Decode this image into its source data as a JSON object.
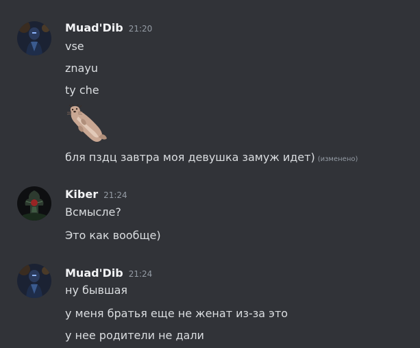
{
  "messages": [
    {
      "username": "Muad'Dib",
      "timestamp": "21:20",
      "lines": [
        "vse",
        "znayu",
        "ty che"
      ],
      "sticker": "otter-sticker",
      "last_line": "бля пздц завтра моя девушка замуж идет)",
      "edited_label": "(изменено)"
    },
    {
      "username": "Kiber",
      "timestamp": "21:24",
      "lines": [
        "Всмысле?",
        "Это как вообще)"
      ]
    },
    {
      "username": "Muad'Dib",
      "timestamp": "21:24",
      "lines": [
        "ну бывшая",
        "у меня братья еще не женат из-за это",
        "у нее родители не дали"
      ]
    }
  ],
  "colors": {
    "background": "#313338",
    "username": "#f2f3f5",
    "text": "#dbdee1",
    "muted": "#949ba4"
  }
}
